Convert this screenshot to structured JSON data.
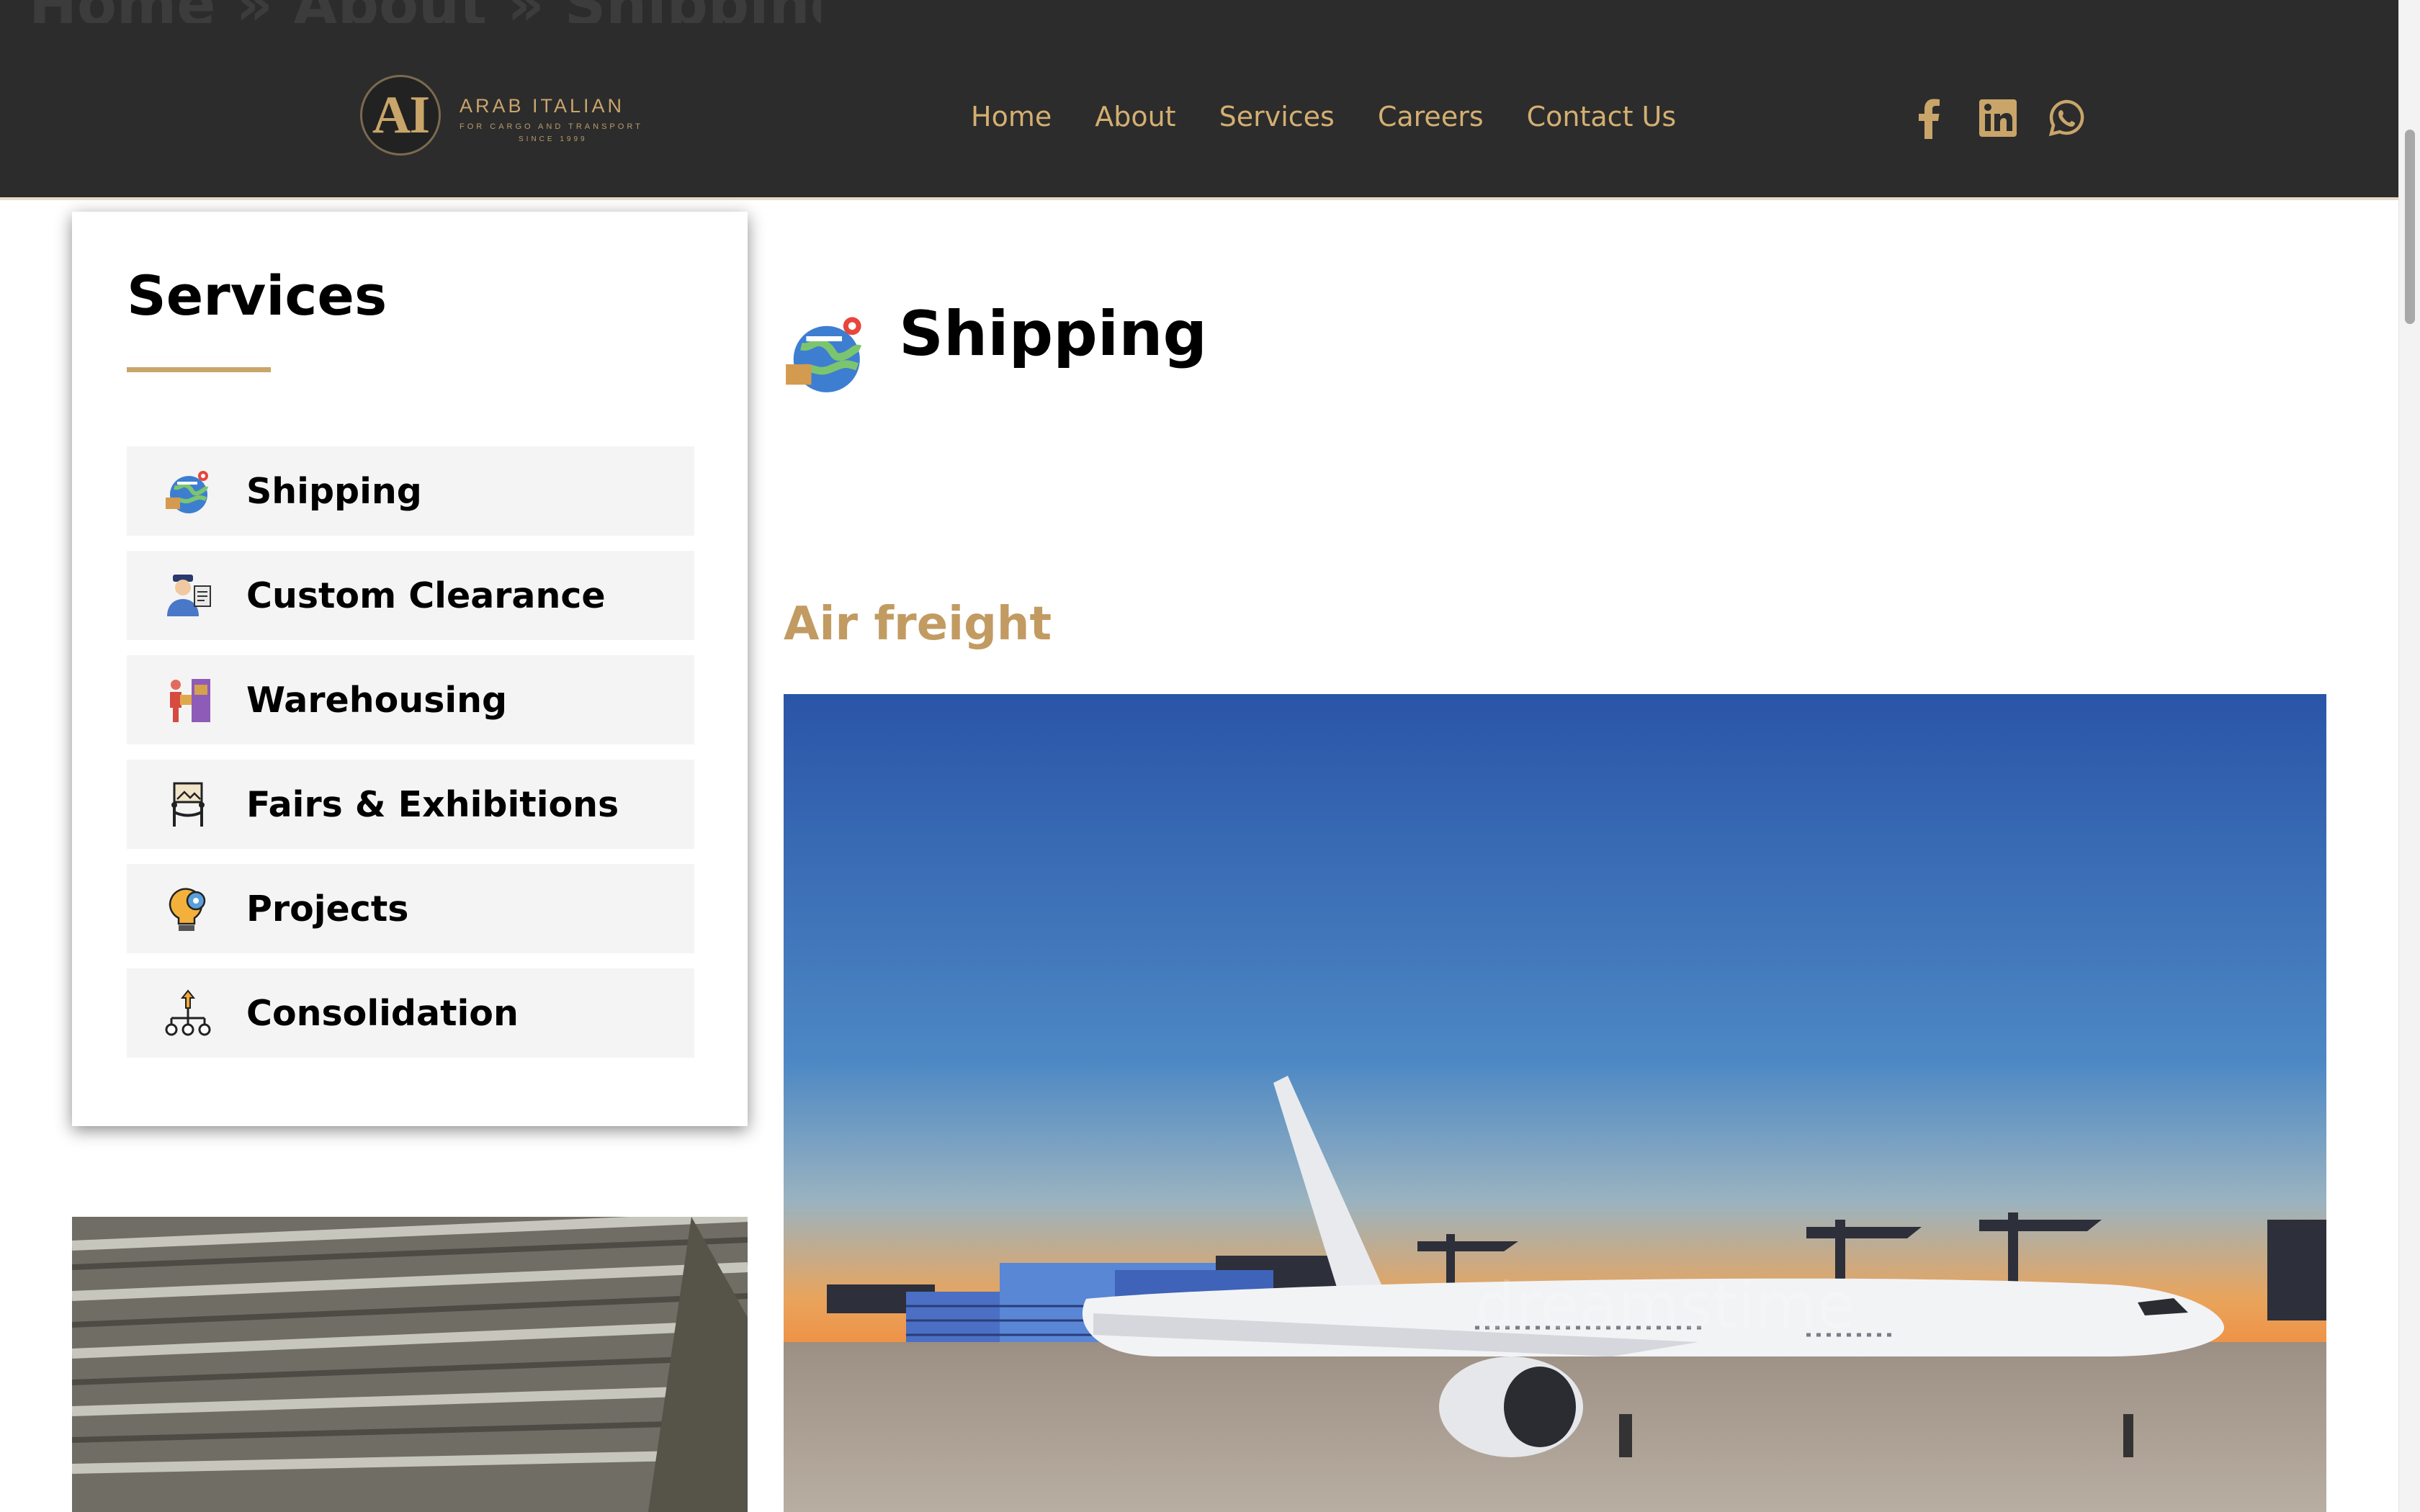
{
  "header": {
    "ghost_text": "Home » About » Shipping",
    "logo": {
      "monogram": "AI",
      "name": "ARAB ITALIAN",
      "tagline": "FOR CARGO AND TRANSPORT",
      "since": "SINCE 1999"
    },
    "nav": [
      {
        "label": "Home"
      },
      {
        "label": "About"
      },
      {
        "label": "Services"
      },
      {
        "label": "Careers"
      },
      {
        "label": "Contact Us"
      }
    ],
    "social": [
      "facebook-icon",
      "linkedin-icon",
      "whatsapp-icon"
    ]
  },
  "sidebar": {
    "title": "Services",
    "items": [
      {
        "label": "Shipping",
        "icon": "globe-shipping-icon"
      },
      {
        "label": "Custom Clearance",
        "icon": "customs-officer-icon"
      },
      {
        "label": "Warehousing",
        "icon": "warehouse-worker-icon"
      },
      {
        "label": "Fairs & Exhibitions",
        "icon": "exhibition-stand-icon"
      },
      {
        "label": "Projects",
        "icon": "lightbulb-gear-icon"
      },
      {
        "label": "Consolidation",
        "icon": "network-hierarchy-icon"
      }
    ]
  },
  "main": {
    "title": "Shipping",
    "subheading": "Air freight",
    "image_watermark": "dreamstime"
  },
  "colors": {
    "accent": "#c9a56a",
    "header_bg": "#2c2c2c",
    "item_bg": "#f4f4f4"
  }
}
